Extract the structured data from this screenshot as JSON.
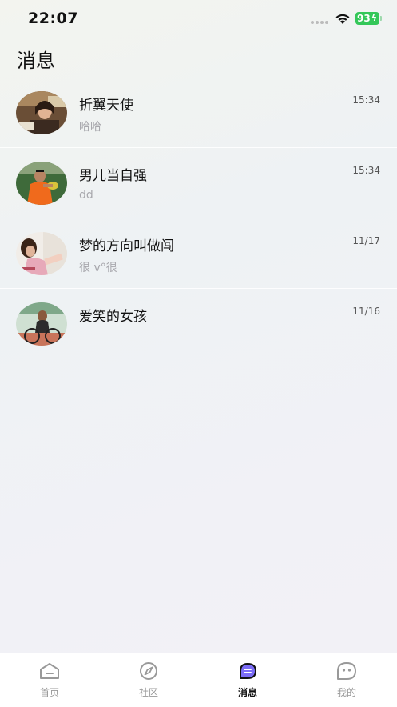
{
  "status_bar": {
    "time": "22:07",
    "battery": "93"
  },
  "page": {
    "title": "消息"
  },
  "conversations": [
    {
      "name": "折翼天使",
      "preview": "哈哈",
      "time": "15:34"
    },
    {
      "name": "男儿当自强",
      "preview": "dd",
      "time": "15:34"
    },
    {
      "name": "梦的方向叫做闯",
      "preview": "很 v°很",
      "time": "11/17"
    },
    {
      "name": "爱笑的女孩",
      "preview": "",
      "time": "11/16"
    }
  ],
  "tabbar": {
    "items": [
      {
        "label": "首页",
        "icon": "home-icon"
      },
      {
        "label": "社区",
        "icon": "compass-icon"
      },
      {
        "label": "消息",
        "icon": "message-icon",
        "active": true
      },
      {
        "label": "我的",
        "icon": "profile-face-icon"
      }
    ]
  },
  "colors": {
    "battery": "#34c759",
    "accent": "#7b6cf6",
    "text_secondary": "#a8a8ad"
  }
}
